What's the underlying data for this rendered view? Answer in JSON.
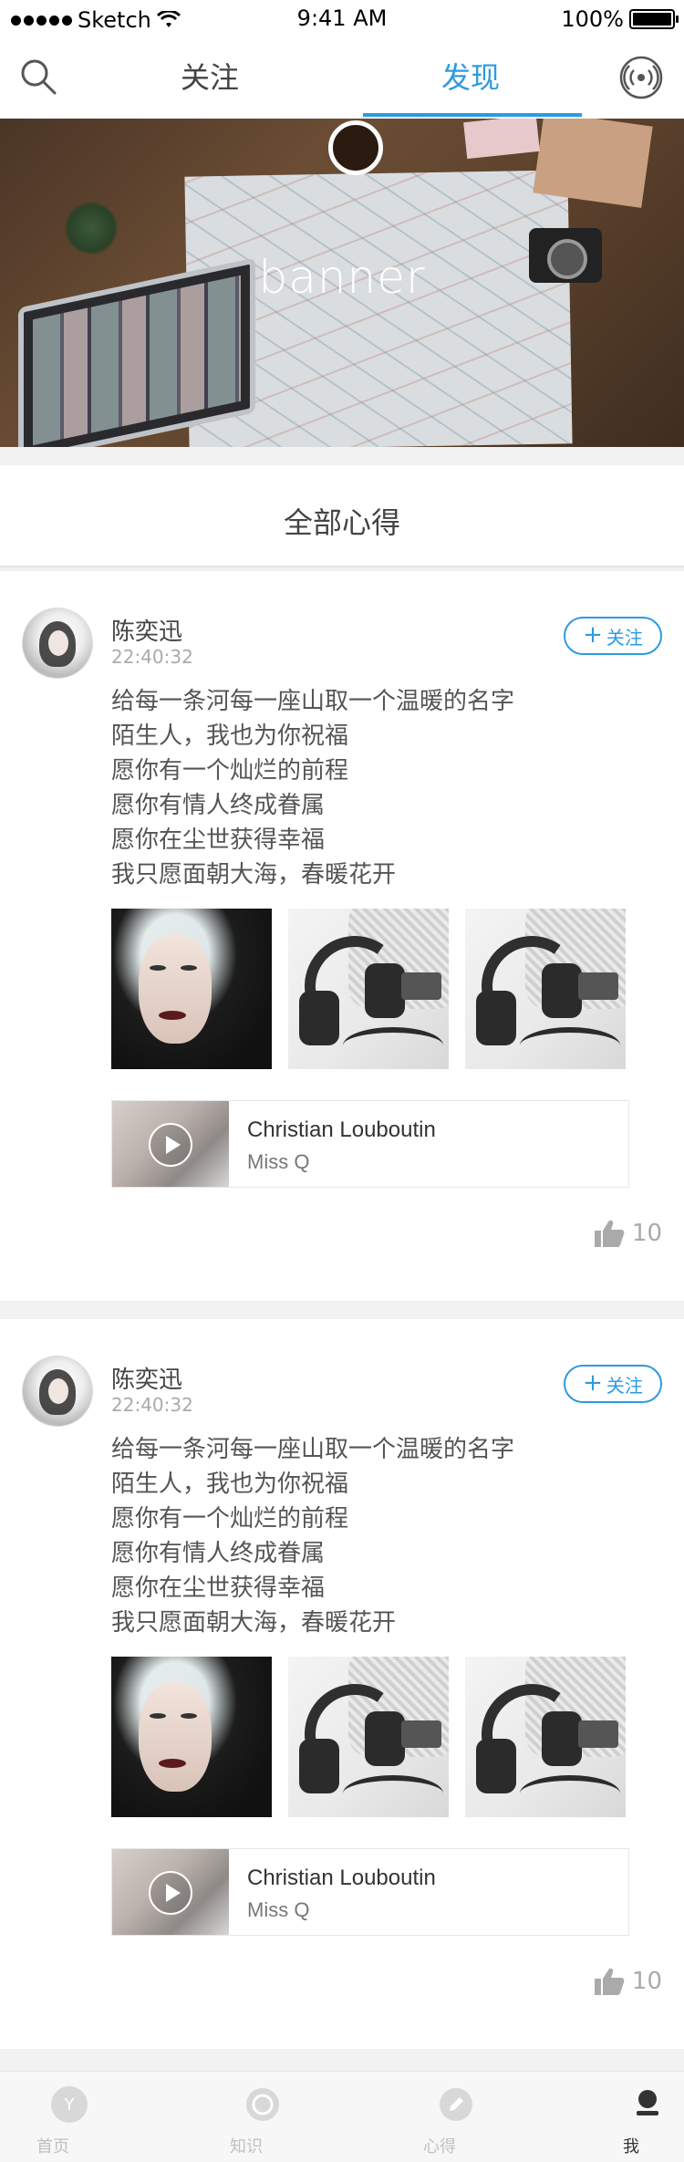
{
  "status_bar": {
    "carrier": "Sketch",
    "time": "9:41 AM",
    "battery": "100%",
    "battery_level": 1.0
  },
  "top_nav": {
    "tabs": [
      {
        "label": "关注"
      },
      {
        "label": "发现"
      }
    ],
    "active_tab": "发现",
    "accent_color": "#2c9be0"
  },
  "banner": {
    "title": "banner"
  },
  "section": {
    "title": "全部心得"
  },
  "posts": [
    {
      "author": "陈奕迅",
      "time": "22:40:32",
      "follow_label": "关注",
      "lines": [
        "给每一条河每一座山取一个温暖的名字",
        "陌生人，我也为你祝福",
        "愿你有一个灿烂的前程",
        "愿你有情人终成眷属",
        "愿你在尘世获得幸福",
        "我只愿面朝大海，春暖花开"
      ],
      "media": {
        "title": "Christian Louboutin",
        "subtitle": "Miss Q"
      },
      "likes": "10"
    },
    {
      "author": "陈奕迅",
      "time": "22:40:32",
      "follow_label": "关注",
      "lines": [
        "给每一条河每一座山取一个温暖的名字",
        "陌生人，我也为你祝福",
        "愿你有一个灿烂的前程",
        "愿你有情人终成眷属",
        "愿你在尘世获得幸福",
        "我只愿面朝大海，春暖花开"
      ],
      "media": {
        "title": "Christian Louboutin",
        "subtitle": "Miss Q"
      },
      "likes": "10"
    }
  ],
  "tab_bar": {
    "items": [
      {
        "label": "首页",
        "icon": "home-y-icon"
      },
      {
        "label": "知识",
        "icon": "knowledge-circle-icon"
      },
      {
        "label": "心得",
        "icon": "pencil-icon"
      },
      {
        "label": "我",
        "icon": "person-icon"
      }
    ],
    "active": "我"
  }
}
